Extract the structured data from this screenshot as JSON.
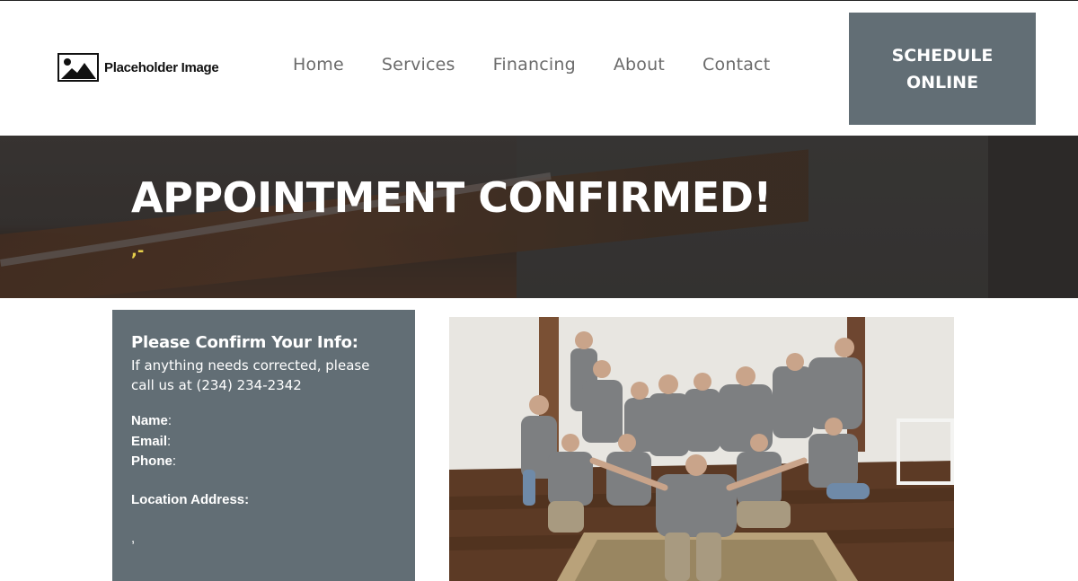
{
  "header": {
    "logo_text": "Placeholder Image",
    "nav": [
      "Home",
      "Services",
      "Financing",
      "About",
      "Contact"
    ],
    "cta_label": "SCHEDULE ONLINE"
  },
  "hero": {
    "title": "APPOINTMENT CONFIRMED!",
    "subtitle": ",-"
  },
  "info": {
    "heading": "Please Confirm Your Info:",
    "lead": "If anything needs corrected, please call us at (234) 234-2342",
    "name_label": "Name",
    "email_label": "Email",
    "phone_label": "Phone",
    "colon": ":",
    "address_label": "Location Address:",
    "address_value": ","
  },
  "colors": {
    "accent": "#626e75",
    "subtitle": "#e7cf4a"
  },
  "photo": {
    "icon": "team-photo"
  }
}
